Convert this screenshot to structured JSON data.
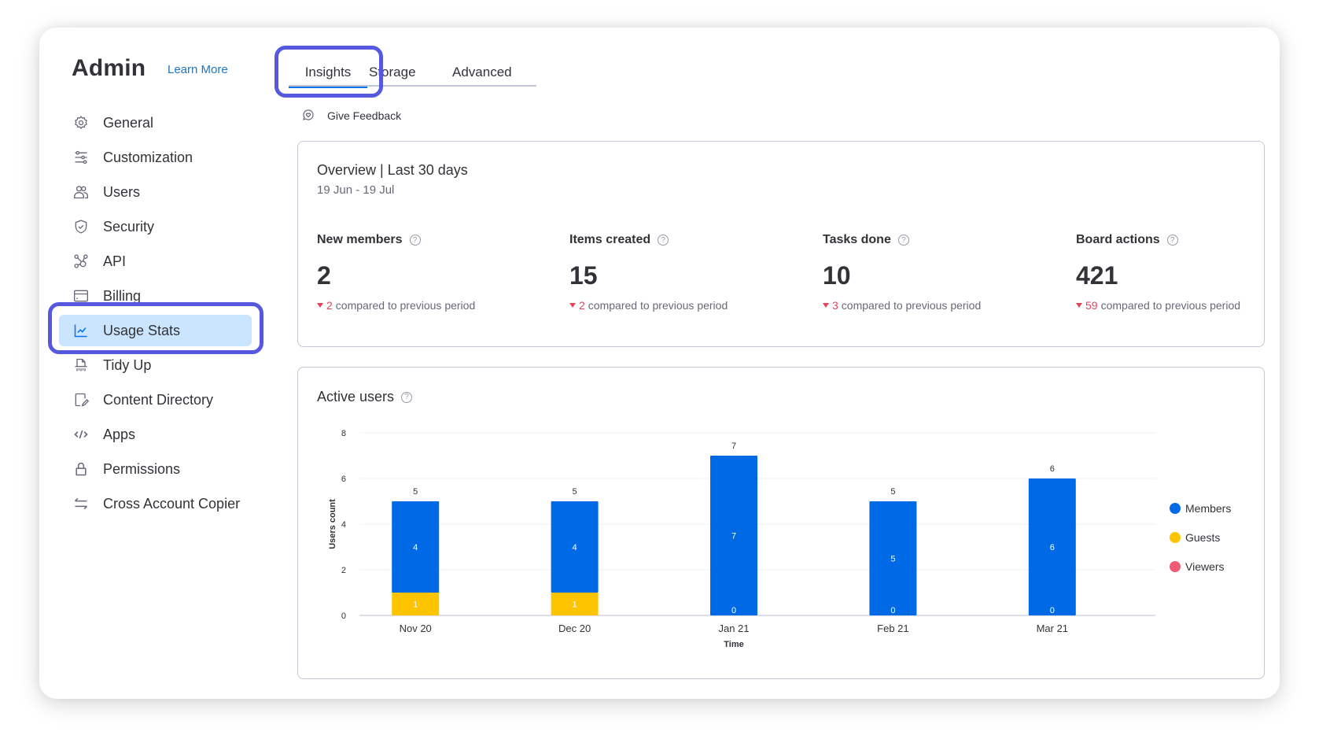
{
  "sidebar": {
    "title": "Admin",
    "learn_more": "Learn More",
    "items": [
      {
        "label": "General",
        "icon": "gear-icon"
      },
      {
        "label": "Customization",
        "icon": "sliders-icon"
      },
      {
        "label": "Users",
        "icon": "users-icon"
      },
      {
        "label": "Security",
        "icon": "shield-icon"
      },
      {
        "label": "API",
        "icon": "api-icon"
      },
      {
        "label": "Billing",
        "icon": "credit-card-icon"
      },
      {
        "label": "Usage Stats",
        "icon": "chart-line-icon",
        "active": true
      },
      {
        "label": "Tidy Up",
        "icon": "shredder-icon"
      },
      {
        "label": "Content Directory",
        "icon": "document-edit-icon"
      },
      {
        "label": "Apps",
        "icon": "code-icon"
      },
      {
        "label": "Permissions",
        "icon": "lock-icon"
      },
      {
        "label": "Cross Account Copier",
        "icon": "swap-arrows-icon"
      }
    ]
  },
  "tabs": [
    {
      "label": "Insights",
      "active": true
    },
    {
      "label": "Storage"
    },
    {
      "label": "Advanced"
    }
  ],
  "feedback": {
    "label": "Give Feedback",
    "icon": "feedback-heart-icon"
  },
  "overview": {
    "title": "Overview | Last 30 days",
    "date_range": "19 Jun - 19 Jul",
    "help_glyph": "?",
    "stats": [
      {
        "label": "New members",
        "value": "2",
        "delta": "2",
        "delta_text": "compared to previous period",
        "trend": "down"
      },
      {
        "label": "Items created",
        "value": "15",
        "delta": "2",
        "delta_text": "compared to previous period",
        "trend": "down"
      },
      {
        "label": "Tasks done",
        "value": "10",
        "delta": "3",
        "delta_text": "compared to previous period",
        "trend": "down"
      },
      {
        "label": "Board actions",
        "value": "421",
        "delta": "59",
        "delta_text": "compared to previous period",
        "trend": "down"
      }
    ]
  },
  "colors": {
    "accent": "#0073ea",
    "highlight": "#5559df",
    "members": "#0069e6",
    "guests": "#ffc400",
    "viewers": "#ef5a74",
    "negative": "#e2445c"
  },
  "chart_data": {
    "type": "bar",
    "stacked": true,
    "title": "Active users",
    "xlabel": "Time",
    "ylabel": "Users count",
    "ylim": [
      0,
      8
    ],
    "yticks": [
      0,
      2,
      4,
      6,
      8
    ],
    "grid": true,
    "legend_position": "right",
    "categories": [
      "Nov 20",
      "Dec 20",
      "Jan 21",
      "Feb 21",
      "Mar 21"
    ],
    "series": [
      {
        "name": "Guests",
        "color": "#ffc400",
        "values": [
          1,
          1,
          0,
          0,
          0
        ]
      },
      {
        "name": "Members",
        "color": "#0069e6",
        "values": [
          4,
          4,
          7,
          5,
          6
        ]
      },
      {
        "name": "Viewers",
        "color": "#ef5a74",
        "values": [
          0,
          0,
          0,
          0,
          0
        ]
      }
    ],
    "totals": [
      5,
      5,
      7,
      5,
      6
    ],
    "legend": [
      "Members",
      "Guests",
      "Viewers"
    ]
  }
}
